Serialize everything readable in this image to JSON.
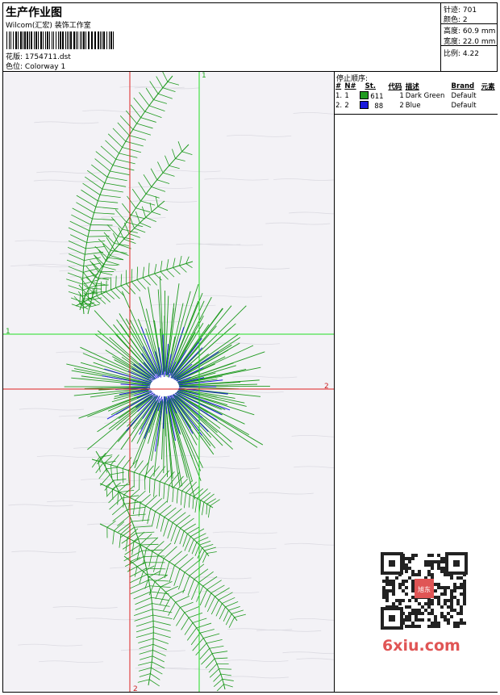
{
  "header": {
    "title": "生产作业图",
    "company": "Wilcom(汇宏) 装饰工作室",
    "design_label": "花版:",
    "design_value": "1754711.dst",
    "color_label": "色位:",
    "color_value": "Colorway 1"
  },
  "stats": {
    "stitches_label": "针迹:",
    "stitches": "701",
    "colors_label": "颜色:",
    "colors": "2",
    "height_label": "高度:",
    "height": "60.9 mm",
    "width_label": "宽度:",
    "width": "22.0 mm",
    "scale_label": "比例:",
    "scale": "4.22"
  },
  "stop_sequence": {
    "title": "停止顺序:",
    "columns": [
      "#",
      "N#",
      "St.",
      "代码",
      "描述",
      "Brand",
      "元素"
    ],
    "rows": [
      {
        "idx": "1.",
        "needle": "1",
        "color": "#1f9a1f",
        "stitches": "611",
        "code": "1",
        "desc": "Dark Green",
        "brand": "Default"
      },
      {
        "idx": "2.",
        "needle": "2",
        "color": "#1a1adc",
        "stitches": "88",
        "code": "2",
        "desc": "Blue",
        "brand": "Default"
      }
    ]
  },
  "axes": {
    "top_green": "1",
    "left_green": "1",
    "right_red": "2",
    "bottom_red": "2"
  },
  "watermark": "6xiu.com",
  "qr_stamp": "旭东图形",
  "colors": {
    "green": "#1f9a1f",
    "blue": "#1a1adc",
    "canvas_bg": "#f3f2f6",
    "watermark": "#e05555"
  }
}
